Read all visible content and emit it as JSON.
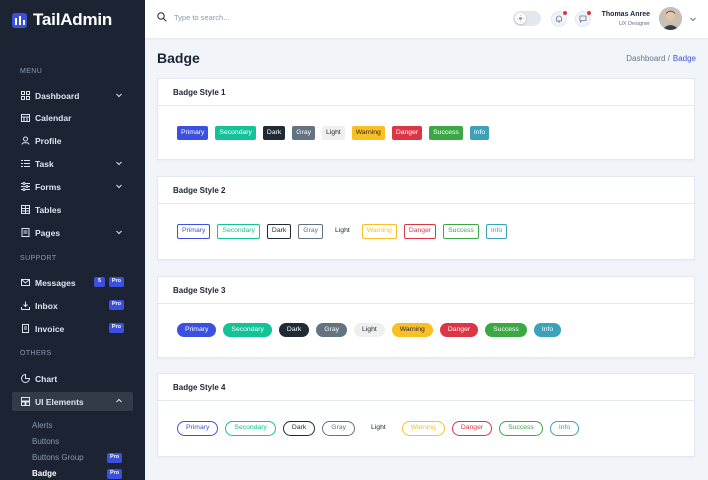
{
  "app": {
    "name": "TailAdmin"
  },
  "sidebar": {
    "sections": [
      "MENU",
      "SUPPORT",
      "OTHERS"
    ],
    "menu": [
      {
        "label": "Dashboard",
        "icon": "grid-icon",
        "chevron": true
      },
      {
        "label": "Calendar",
        "icon": "calendar-icon"
      },
      {
        "label": "Profile",
        "icon": "user-icon"
      },
      {
        "label": "Task",
        "icon": "list-icon",
        "chevron": true
      },
      {
        "label": "Forms",
        "icon": "forms-icon",
        "chevron": true
      },
      {
        "label": "Tables",
        "icon": "table-icon"
      },
      {
        "label": "Pages",
        "icon": "pages-icon",
        "chevron": true
      }
    ],
    "support": [
      {
        "label": "Messages",
        "icon": "mail-icon",
        "count": "5",
        "badge": "Pro"
      },
      {
        "label": "Inbox",
        "icon": "inbox-icon",
        "badge": "Pro"
      },
      {
        "label": "Invoice",
        "icon": "invoice-icon",
        "badge": "Pro"
      }
    ],
    "others": [
      {
        "label": "Chart",
        "icon": "chart-icon"
      },
      {
        "label": "UI Elements",
        "icon": "ui-elements-icon",
        "chevron": true,
        "expanded": true
      }
    ],
    "ui_elements_sub": [
      {
        "label": "Alerts"
      },
      {
        "label": "Buttons"
      },
      {
        "label": "Buttons Group",
        "badge": "Pro"
      },
      {
        "label": "Badge",
        "badge": "Pro",
        "active": true
      }
    ]
  },
  "header": {
    "search_placeholder": "Type to search...",
    "user_name": "Thomas Anree",
    "user_role": "UX Designer"
  },
  "page": {
    "title": "Badge",
    "breadcrumb": [
      "Dashboard /",
      "Badge"
    ]
  },
  "badge_colors": {
    "Primary": "#3c50e0",
    "Secondary": "#13c296",
    "Dark": "#212b36",
    "Gray": "#637381",
    "Light": "#efefef",
    "Warning": "#fbbf24",
    "Danger": "#dc3545",
    "Success": "#3ca745",
    "Info": "#3ba2b8"
  },
  "cards": [
    {
      "title": "Badge Style 1",
      "style": "s1",
      "badges": [
        "Primary",
        "Secondary",
        "Dark",
        "Gray",
        "Light",
        "Warning",
        "Danger",
        "Success",
        "Info"
      ]
    },
    {
      "title": "Badge Style 2",
      "style": "s2",
      "badges": [
        "Primary",
        "Secondary",
        "Dark",
        "Gray",
        "Light",
        "Warning",
        "Danger",
        "Success",
        "Info"
      ]
    },
    {
      "title": "Badge Style 3",
      "style": "s3",
      "badges": [
        "Primary",
        "Secondary",
        "Dark",
        "Gray",
        "Light",
        "Warning",
        "Danger",
        "Success",
        "Info"
      ]
    },
    {
      "title": "Badge Style 4",
      "style": "s4",
      "badges": [
        "Primary",
        "Secondary",
        "Dark",
        "Gray",
        "Light",
        "Warning",
        "Danger",
        "Success",
        "Info"
      ]
    }
  ]
}
